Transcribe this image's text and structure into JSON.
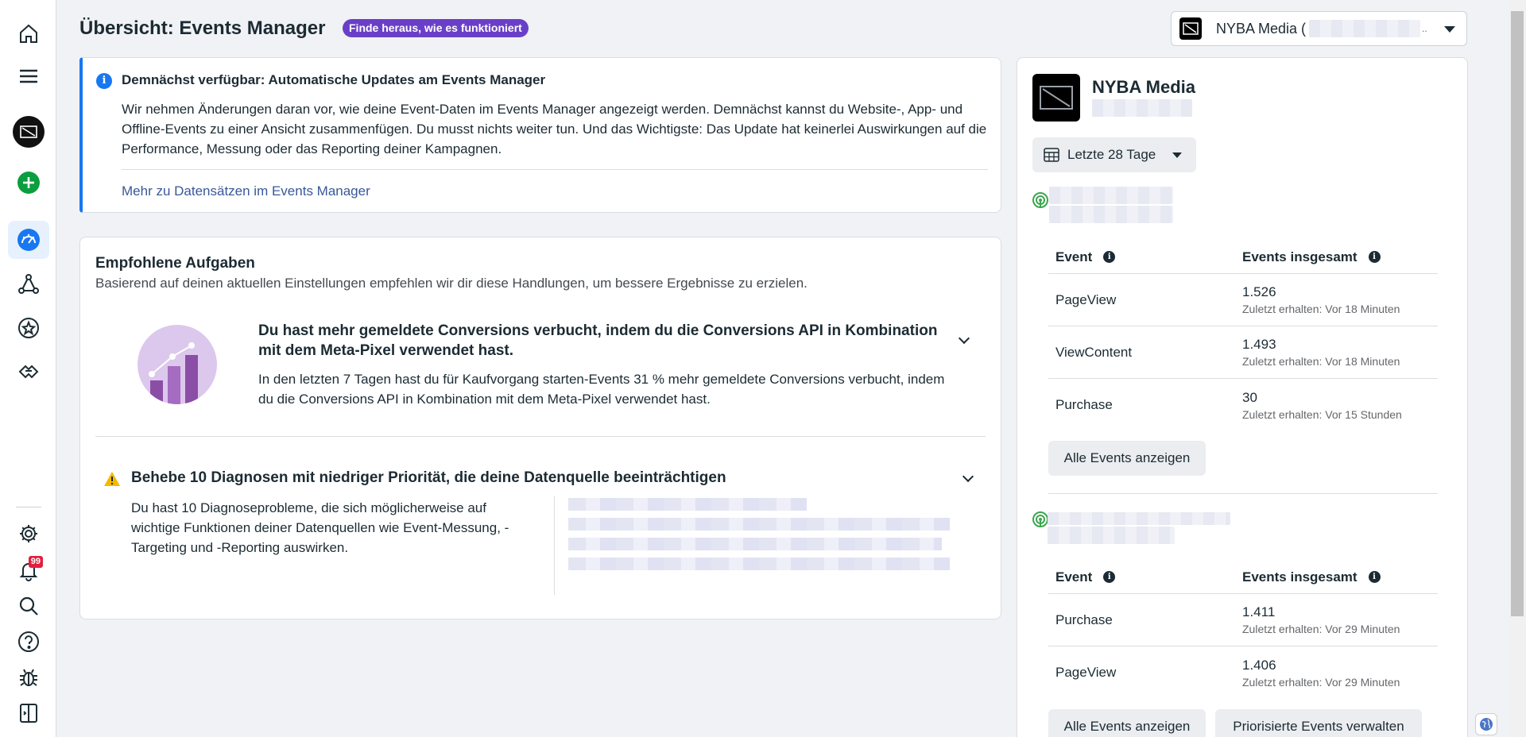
{
  "header": {
    "title": "Übersicht: Events Manager",
    "howto_label": "Finde heraus, wie es funktioniert"
  },
  "account_selector": {
    "name": "NYBA Media (",
    "suffix": ".."
  },
  "sidebar": {
    "items": [
      {
        "name": "home-icon"
      },
      {
        "name": "menu-icon"
      },
      {
        "name": "account-avatar"
      },
      {
        "name": "add-icon"
      },
      {
        "name": "overview-icon",
        "active": true
      },
      {
        "name": "data-sources-icon"
      },
      {
        "name": "custom-conversions-icon"
      },
      {
        "name": "partner-integrations-icon"
      },
      {
        "name": "gear-icon"
      },
      {
        "name": "bell-icon"
      },
      {
        "name": "search-icon"
      },
      {
        "name": "help-icon"
      },
      {
        "name": "bug-icon"
      },
      {
        "name": "panel-toggle-icon"
      }
    ],
    "notification_count": "99"
  },
  "notice": {
    "title": "Demnächst verfügbar: Automatische Updates am Events Manager",
    "body": "Wir nehmen Änderungen daran vor, wie deine Event-Daten im Events Manager angezeigt werden. Demnächst kannst du Website-, App- und Offline-Events zu einer Ansicht zusammenfügen. Du musst nichts weiter tun. Und das Wichtigste: Das Update hat keinerlei Auswirkungen auf die Performance, Messung oder das Reporting deiner Kampagnen.",
    "link": "Mehr zu Datensätzen im Events Manager"
  },
  "tasks": {
    "title": "Empfohlene Aufgaben",
    "subtitle": "Basierend auf deinen aktuellen Einstellungen empfehlen wir dir diese Handlungen, um bessere Ergebnisse zu erzielen.",
    "task1": {
      "title": "Du hast mehr gemeldete Conversions verbucht, indem du die Conversions API in Kombination mit dem Meta-Pixel verwendet hast.",
      "body": "In den letzten 7 Tagen hast du für Kaufvorgang starten-Events 31 % mehr gemeldete Conversions verbucht, indem du die Conversions API in Kombination mit dem Meta-Pixel verwendet hast."
    },
    "task2": {
      "title": "Behebe 10 Diagnosen mit niedriger Priorität, die deine Datenquelle beeinträchtigen",
      "body": "Du hast 10 Diagnoseprobleme, die sich möglicherweise auf wichtige Funktionen deiner Datenquellen wie Event-Messung, -Targeting und -Reporting auswirken."
    }
  },
  "panel": {
    "name": "NYBA Media",
    "date_range": "Letzte 28 Tage",
    "col_event": "Event",
    "col_total": "Events insgesamt",
    "source1": {
      "rows": [
        {
          "event": "PageView",
          "count": "1.526",
          "last": "Zuletzt erhalten: Vor 18 Minuten"
        },
        {
          "event": "ViewContent",
          "count": "1.493",
          "last": "Zuletzt erhalten: Vor 18 Minuten"
        },
        {
          "event": "Purchase",
          "count": "30",
          "last": "Zuletzt erhalten: Vor 15 Stunden"
        }
      ]
    },
    "source2": {
      "rows": [
        {
          "event": "Purchase",
          "count": "1.411",
          "last": "Zuletzt erhalten: Vor 29 Minuten"
        },
        {
          "event": "PageView",
          "count": "1.406",
          "last": "Zuletzt erhalten: Vor 29 Minuten"
        }
      ]
    },
    "all_events_btn": "Alle Events anzeigen",
    "prioritized_btn": "Priorisierte Events verwalten"
  }
}
